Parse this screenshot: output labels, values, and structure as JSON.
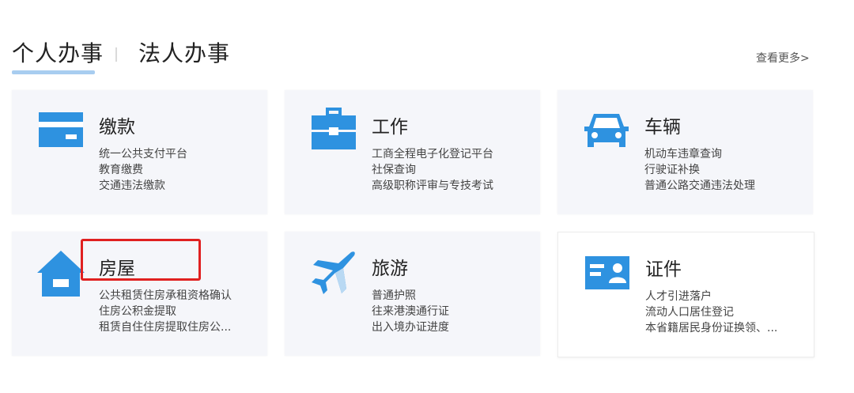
{
  "tabs": {
    "personal": "个人办事",
    "legal": "法人办事"
  },
  "more_link": "查看更多>",
  "accent_color": "#2e92e0",
  "highlight_color": "#e02020",
  "cards": [
    {
      "icon": "card-payment-icon",
      "title": "缴款",
      "lines": [
        "统一公共支付平台",
        "教育缴费",
        "交通违法缴款"
      ]
    },
    {
      "icon": "briefcase-icon",
      "title": "工作",
      "lines": [
        "工商全程电子化登记平台",
        "社保查询",
        "高级职称评审与专技考试"
      ]
    },
    {
      "icon": "car-icon",
      "title": "车辆",
      "lines": [
        "机动车违章查询",
        "行驶证补换",
        "普通公路交通违法处理"
      ]
    },
    {
      "icon": "house-icon",
      "title": "房屋",
      "lines": [
        "公共租赁住房承租资格确认",
        "住房公积金提取",
        "租赁自住住房提取住房公..."
      ]
    },
    {
      "icon": "airplane-icon",
      "title": "旅游",
      "lines": [
        "普通护照",
        "往来港澳通行证",
        "出入境办证进度"
      ]
    },
    {
      "icon": "id-card-icon",
      "title": "证件",
      "lines": [
        "人才引进落户",
        "流动人口居住登记",
        "本省籍居民身份证换领、..."
      ]
    }
  ]
}
